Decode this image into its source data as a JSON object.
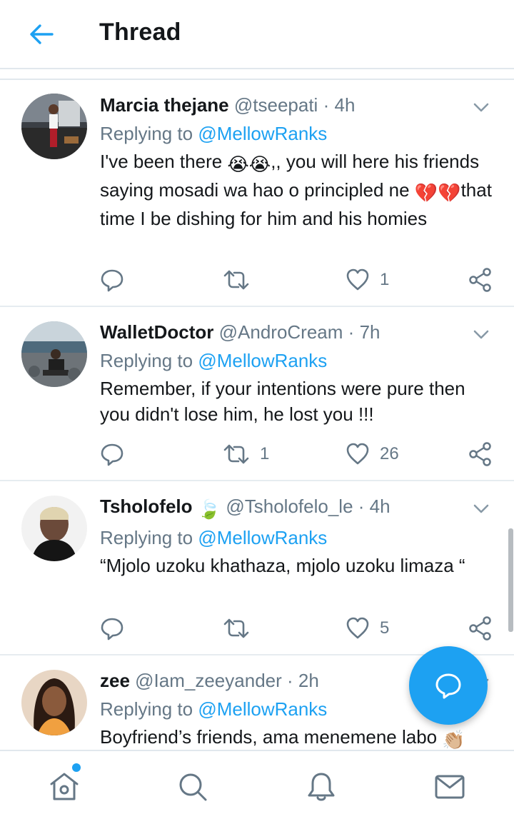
{
  "header": {
    "title": "Thread"
  },
  "colors": {
    "accent": "#1da1f2",
    "muted": "#657786",
    "text": "#14171a",
    "divider": "#e6ecf0",
    "heart_red": "#e0245e"
  },
  "tweets": [
    {
      "name": "Marcia thejane",
      "handle": "@tseepati",
      "dot": "·",
      "time": "4h",
      "replying_prefix": "Replying to ",
      "replying_to": "@MellowRanks",
      "text_parts": [
        "I've been there ",
        "😭😭",
        ",, you will here his friends saying mosadi wa hao o principled ne ",
        "💔💔",
        "that time I be dishing for him and his homies"
      ],
      "replies": "",
      "retweets": "",
      "likes": "1"
    },
    {
      "name": "WalletDoctor",
      "handle": "@AndroCream",
      "dot": "·",
      "time": "7h",
      "replying_prefix": "Replying to ",
      "replying_to": "@MellowRanks",
      "text": "Remember, if your intentions were pure then you didn't lose him, he lost you !!!",
      "replies": "",
      "retweets": "1",
      "likes": "26"
    },
    {
      "name": "Tsholofelo",
      "name_emoji": "🍃",
      "handle": "@Tsholofelo_le",
      "dot": "·",
      "time": "4h",
      "replying_prefix": "Replying to ",
      "replying_to": "@MellowRanks",
      "text": "“Mjolo uzoku khathaza, mjolo uzoku limaza “",
      "replies": "",
      "retweets": "",
      "likes": "5"
    },
    {
      "name": "zee",
      "handle": "@Iam_zeeyander",
      "dot": "·",
      "time": "2h",
      "replying_prefix": "Replying to ",
      "replying_to": "@MellowRanks",
      "text": "Boyfriend’s friends, ama menemene labo",
      "text_emoji": "👏🏼"
    }
  ],
  "nav": {
    "items": [
      "home-icon",
      "search-icon",
      "notifications-icon",
      "messages-icon"
    ]
  },
  "fab": {
    "icon": "compose-reply-icon"
  }
}
